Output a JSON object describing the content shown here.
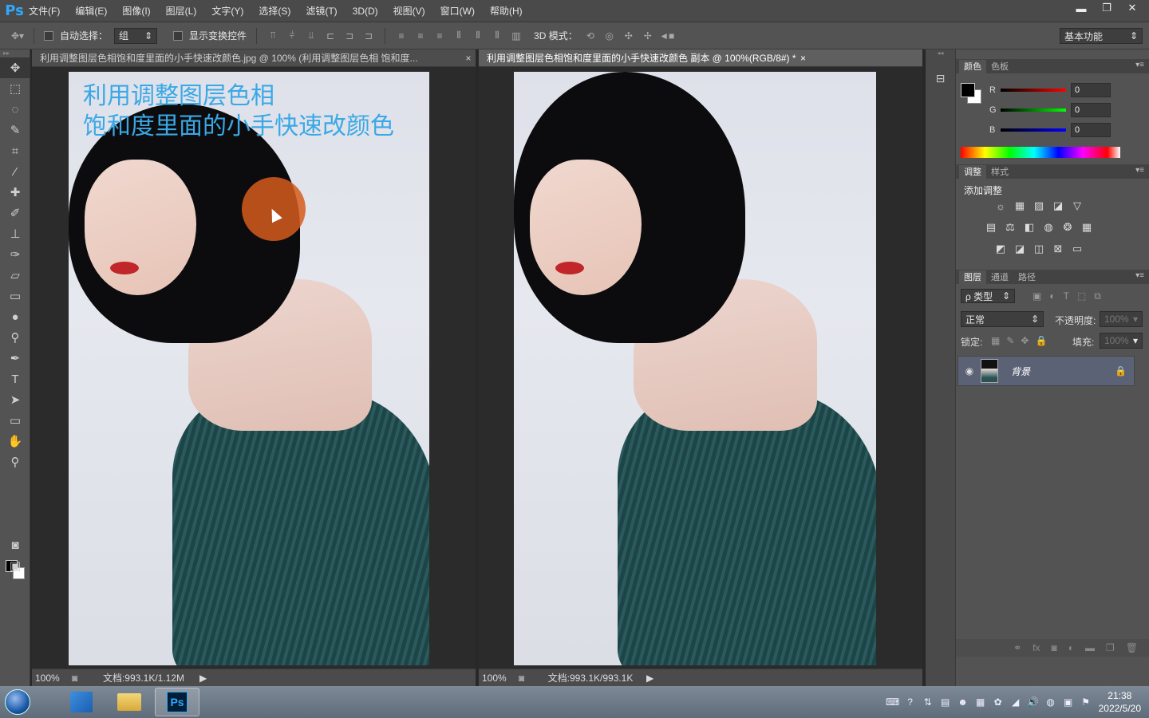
{
  "app": {
    "logo": "Ps"
  },
  "menu": [
    "文件(F)",
    "编辑(E)",
    "图像(I)",
    "图层(L)",
    "文字(Y)",
    "选择(S)",
    "滤镜(T)",
    "3D(D)",
    "视图(V)",
    "窗口(W)",
    "帮助(H)"
  ],
  "window_controls": {
    "minimize": "▬",
    "restore": "❐",
    "close": "✕"
  },
  "options": {
    "auto_select_label": "自动选择：",
    "auto_select_value": "组",
    "show_transform_label": "显示变换控件",
    "mode3d_label": "3D 模式：",
    "workspace": "基本功能"
  },
  "docs": [
    {
      "tab": "利用调整图层色相饱和度里面的小手快速改颜色.jpg @ 100% (利用调整图层色相 饱和度...",
      "zoom": "100%",
      "doc_size": "文档:993.1K/1.12M",
      "overlay": [
        "利用调整图层色相",
        "饱和度里面的小手快速改颜色"
      ]
    },
    {
      "tab": "利用调整图层色相饱和度里面的小手快速改颜色 副本 @ 100%(RGB/8#) *",
      "zoom": "100%",
      "doc_size": "文档:993.1K/993.1K"
    }
  ],
  "close_glyph": "×",
  "color_panel": {
    "tabs": [
      "颜色",
      "色板"
    ],
    "r_label": "R",
    "g_label": "G",
    "b_label": "B",
    "r": "0",
    "g": "0",
    "b": "0"
  },
  "adjust_panel": {
    "tabs": [
      "调整",
      "样式"
    ],
    "title": "添加调整"
  },
  "layers_panel": {
    "tabs": [
      "图层",
      "通道",
      "路径"
    ],
    "filter": "ρ 类型",
    "blend": "正常",
    "opacity_label": "不透明度:",
    "opacity": "100%",
    "lock_label": "锁定:",
    "fill_label": "填充:",
    "fill": "100%",
    "layer_name": "背景"
  },
  "taskbar": {
    "time": "21:38",
    "date": "2022/5/20",
    "ps_label": "Ps"
  },
  "colors": {
    "accent": "#31a8ff",
    "overlay_text": "#3aa8e6",
    "cursor": "#d65c1c",
    "layer_selected": "#5c6276"
  }
}
